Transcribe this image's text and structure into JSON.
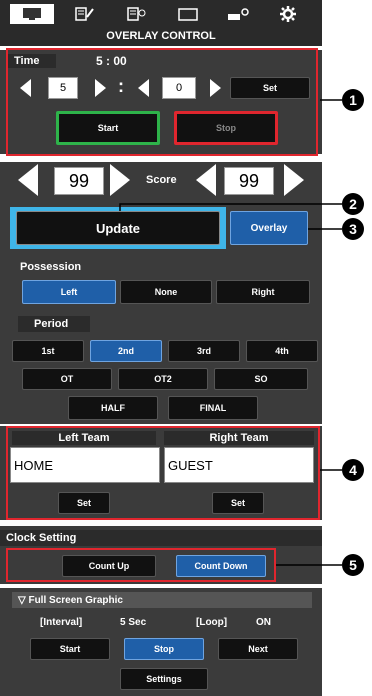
{
  "header": {
    "title": "OVERLAY CONTROL",
    "tabs": [
      "display-icon",
      "edit-list-icon",
      "list-settings-icon",
      "window-icon",
      "camera-settings-icon",
      "gear-icon"
    ]
  },
  "time": {
    "label": "Time",
    "display": "5 : 00",
    "minutes": "5",
    "colon": ":",
    "seconds": "0",
    "set_label": "Set",
    "start_label": "Start",
    "stop_label": "Stop",
    "start_border": "#2eb34a",
    "stop_border": "#e0262e"
  },
  "score": {
    "left": "99",
    "label": "Score",
    "right": "99"
  },
  "actions": {
    "update_label": "Update",
    "overlay_label": "Overlay"
  },
  "possession": {
    "label": "Possession",
    "options": [
      "Left",
      "None",
      "Right"
    ],
    "selected": "Left"
  },
  "period": {
    "label": "Period",
    "row1": [
      "1st",
      "2nd",
      "3rd",
      "4th"
    ],
    "row2": [
      "OT",
      "OT2",
      "SO"
    ],
    "row3": [
      "HALF",
      "FINAL"
    ],
    "selected": "2nd"
  },
  "teams": {
    "left_label": "Left Team",
    "right_label": "Right Team",
    "left_value": "HOME",
    "right_value": "GUEST",
    "set_label": "Set"
  },
  "clock": {
    "label": "Clock Setting",
    "count_up": "Count Up",
    "count_down": "Count Down",
    "selected": "Count Down"
  },
  "fullscreen": {
    "label": "▽ Full Screen Graphic",
    "interval_label": "[Interval]",
    "interval_value": "5 Sec",
    "loop_label": "[Loop]",
    "loop_value": "ON",
    "start_label": "Start",
    "stop_label": "Stop",
    "next_label": "Next",
    "settings_label": "Settings"
  },
  "callouts": [
    "1",
    "2",
    "3",
    "4",
    "5"
  ],
  "colors": {
    "accent_blue": "#1f5fa8",
    "callout_red": "#e0262e",
    "panel": "#3b3b3b"
  }
}
